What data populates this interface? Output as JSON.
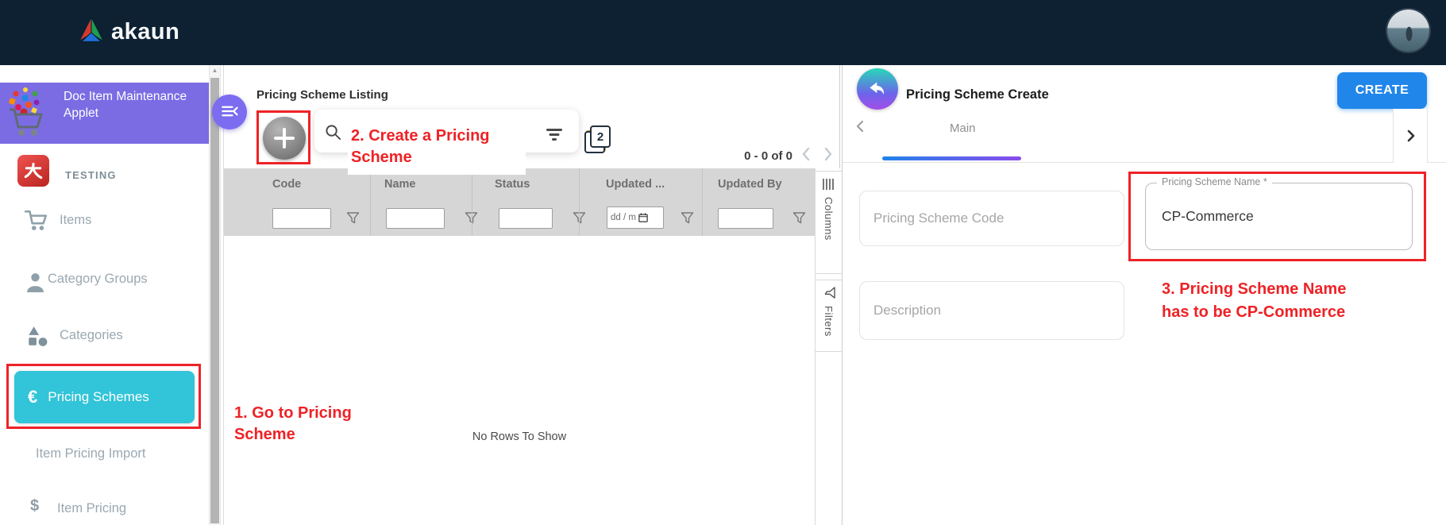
{
  "navbar": {
    "logo_text": "akaun"
  },
  "sidebar": {
    "applet_title": "Doc Item Maintenance Applet",
    "section_label": "TESTING",
    "items": [
      {
        "icon": "cart-icon",
        "label": "Items"
      },
      {
        "icon": "person-icon",
        "label": "Category Groups"
      },
      {
        "icon": "shapes-icon",
        "label": "Categories"
      },
      {
        "icon": "euro-icon",
        "glyph": "€",
        "label": "Pricing Schemes",
        "active": true
      },
      {
        "icon": null,
        "label": "Item Pricing Import"
      },
      {
        "icon": "dollar-icon",
        "glyph": "$",
        "label": "Item Pricing"
      }
    ]
  },
  "listing": {
    "title": "Pricing Scheme Listing",
    "search": {
      "placeholder": ""
    },
    "pagination": {
      "summary": "0 - 0 of 0"
    },
    "table": {
      "columns": [
        "Code",
        "Name",
        "Status",
        "Updated ...",
        "Updated By"
      ],
      "date_filter_placeholder": "dd / m",
      "empty_text": "No Rows To Show"
    },
    "side_tabs": [
      {
        "icon": "columns-icon",
        "label": "Columns"
      },
      {
        "icon": "funnel-icon",
        "label": "Filters"
      }
    ]
  },
  "create_panel": {
    "title": "Pricing Scheme Create",
    "create_button_label": "CREATE",
    "active_tab": "Main",
    "fields": {
      "code": {
        "placeholder": "Pricing Scheme Code",
        "value": ""
      },
      "name": {
        "label": "Pricing Scheme Name *",
        "value": "CP-Commerce"
      },
      "description": {
        "placeholder": "Description",
        "value": ""
      }
    }
  },
  "annotations": {
    "color": "#ee2226",
    "step1": {
      "line1": "1. Go to Pricing",
      "line2": "Scheme"
    },
    "step2": {
      "line1": "2. Create a Pricing",
      "line2": "Scheme"
    },
    "step3": {
      "line1": "3. Pricing Scheme Name",
      "line2": "has to be CP-Commerce"
    }
  },
  "colors": {
    "navbar_bg": "#0d2133",
    "applet_purple": "#7b6ce4",
    "active_cyan": "#32c4d8",
    "annotation_red": "#ee2226",
    "create_blue": "#2186ea",
    "grid_header_gray": "#d6d6d6"
  }
}
